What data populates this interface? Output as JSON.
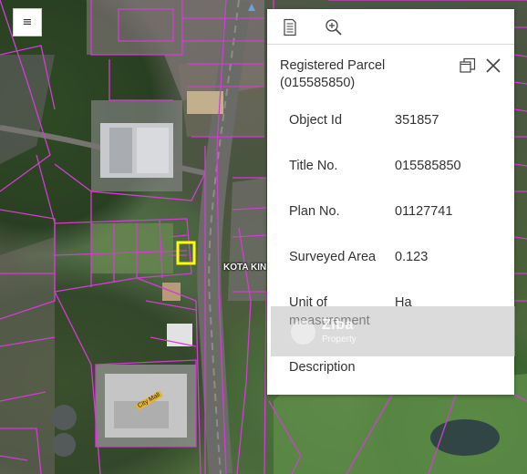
{
  "map": {
    "road_label": "KOTA KIN",
    "poi_label": "City Mall",
    "parcel_color": "#cf3fd0",
    "highlight_color": "#ffff00"
  },
  "menu_button": {
    "icon": "hamburger-menu-icon",
    "label": "≡"
  },
  "popup": {
    "toolbar": [
      {
        "icon": "document-icon"
      },
      {
        "icon": "zoom-in-icon"
      }
    ],
    "title": "Registered Parcel (015585850)",
    "dock_icon": "dock-icon",
    "close_icon": "close-icon",
    "attributes": [
      {
        "label": "Object Id",
        "value": "351857"
      },
      {
        "label": "Title No.",
        "value": "015585850"
      },
      {
        "label": "Plan No.",
        "value": "01127741"
      },
      {
        "label": "Surveyed Area",
        "value": "0.123"
      },
      {
        "label": "Unit of measurement",
        "value": "Ha"
      },
      {
        "label": "Description",
        "value": ""
      }
    ]
  },
  "watermark": {
    "name": "Ziba",
    "sub": "Property"
  }
}
